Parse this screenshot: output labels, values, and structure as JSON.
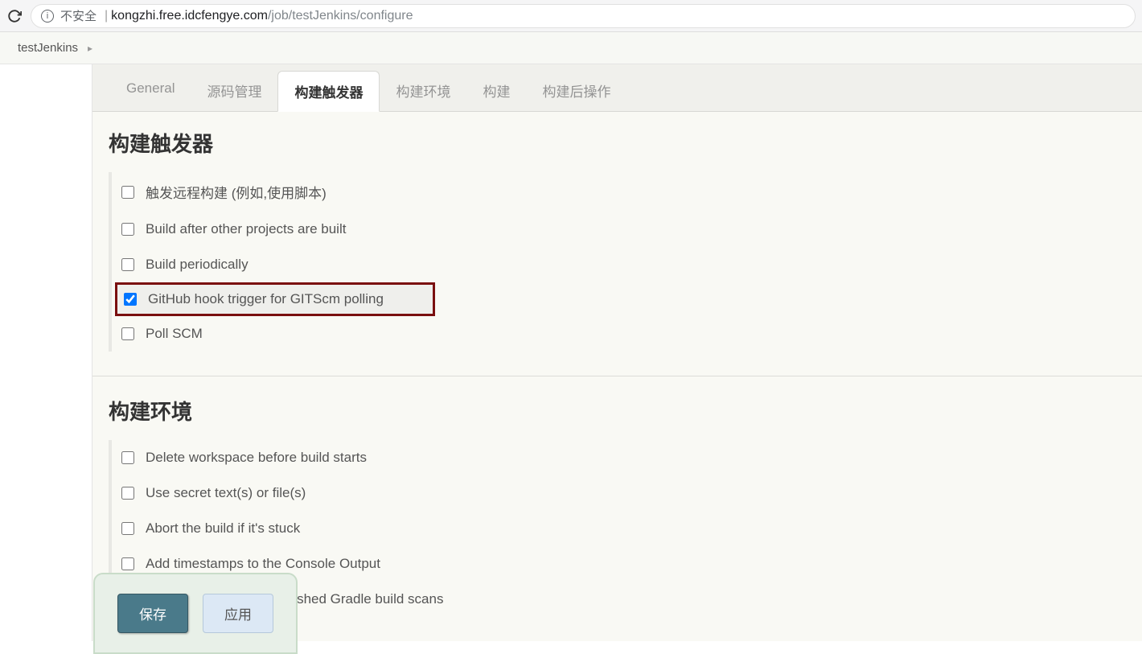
{
  "browser": {
    "security_label": "不安全",
    "url_host": "kongzhi.free.idcfengye.com",
    "url_path": "/job/testJenkins/configure"
  },
  "breadcrumbs": {
    "items": [
      "testJenkins"
    ]
  },
  "tabs": [
    {
      "label": "General",
      "active": false
    },
    {
      "label": "源码管理",
      "active": false
    },
    {
      "label": "构建触发器",
      "active": true
    },
    {
      "label": "构建环境",
      "active": false
    },
    {
      "label": "构建",
      "active": false
    },
    {
      "label": "构建后操作",
      "active": false
    }
  ],
  "sections": {
    "triggers": {
      "title": "构建触发器",
      "options": [
        {
          "label": "触发远程构建 (例如,使用脚本)",
          "checked": false
        },
        {
          "label": "Build after other projects are built",
          "checked": false
        },
        {
          "label": "Build periodically",
          "checked": false
        },
        {
          "label": "GitHub hook trigger for GITScm polling",
          "checked": true,
          "highlighted": true
        },
        {
          "label": "Poll SCM",
          "checked": false
        }
      ]
    },
    "env": {
      "title": "构建环境",
      "options": [
        {
          "label": "Delete workspace before build starts",
          "checked": false
        },
        {
          "label": "Use secret text(s) or file(s)",
          "checked": false
        },
        {
          "label": "Abort the build if it's stuck",
          "checked": false
        },
        {
          "label": "Add timestamps to the Console Output",
          "checked": false
        },
        {
          "label": "Inspect build log for published Gradle build scans",
          "checked": false
        }
      ]
    }
  },
  "buttons": {
    "save": "保存",
    "apply": "应用"
  }
}
